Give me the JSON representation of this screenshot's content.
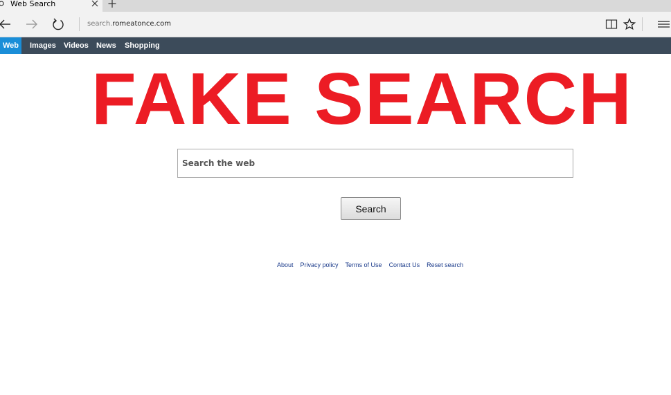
{
  "tab": {
    "title": "Web Search",
    "favicon": "search-icon"
  },
  "address_bar": {
    "url_prefix": "search.",
    "url_domain": "romeatonce.com"
  },
  "toolbar_icons": [
    "back-arrow-icon",
    "forward-arrow-icon",
    "refresh-icon",
    "reading-view-icon",
    "star-favorite-icon",
    "hamburger-menu-icon"
  ],
  "nav": {
    "items": [
      {
        "label": "Web",
        "active": true
      },
      {
        "label": "Images",
        "active": false
      },
      {
        "label": "Videos",
        "active": false
      },
      {
        "label": "News",
        "active": false
      },
      {
        "label": "Shopping",
        "active": false
      }
    ]
  },
  "overlay": {
    "text": "FAKE SEARCH",
    "color": "#ec1c24"
  },
  "search": {
    "placeholder": "Search the web",
    "value": "",
    "button_label": "Search"
  },
  "footer": {
    "links": [
      "About",
      "Privacy policy",
      "Terms of Use",
      "Contact Us",
      "Reset search"
    ]
  },
  "colors": {
    "navbar": "#3c4b5a",
    "nav_active": "#1a8ed8",
    "link": "#1a3a8a"
  }
}
